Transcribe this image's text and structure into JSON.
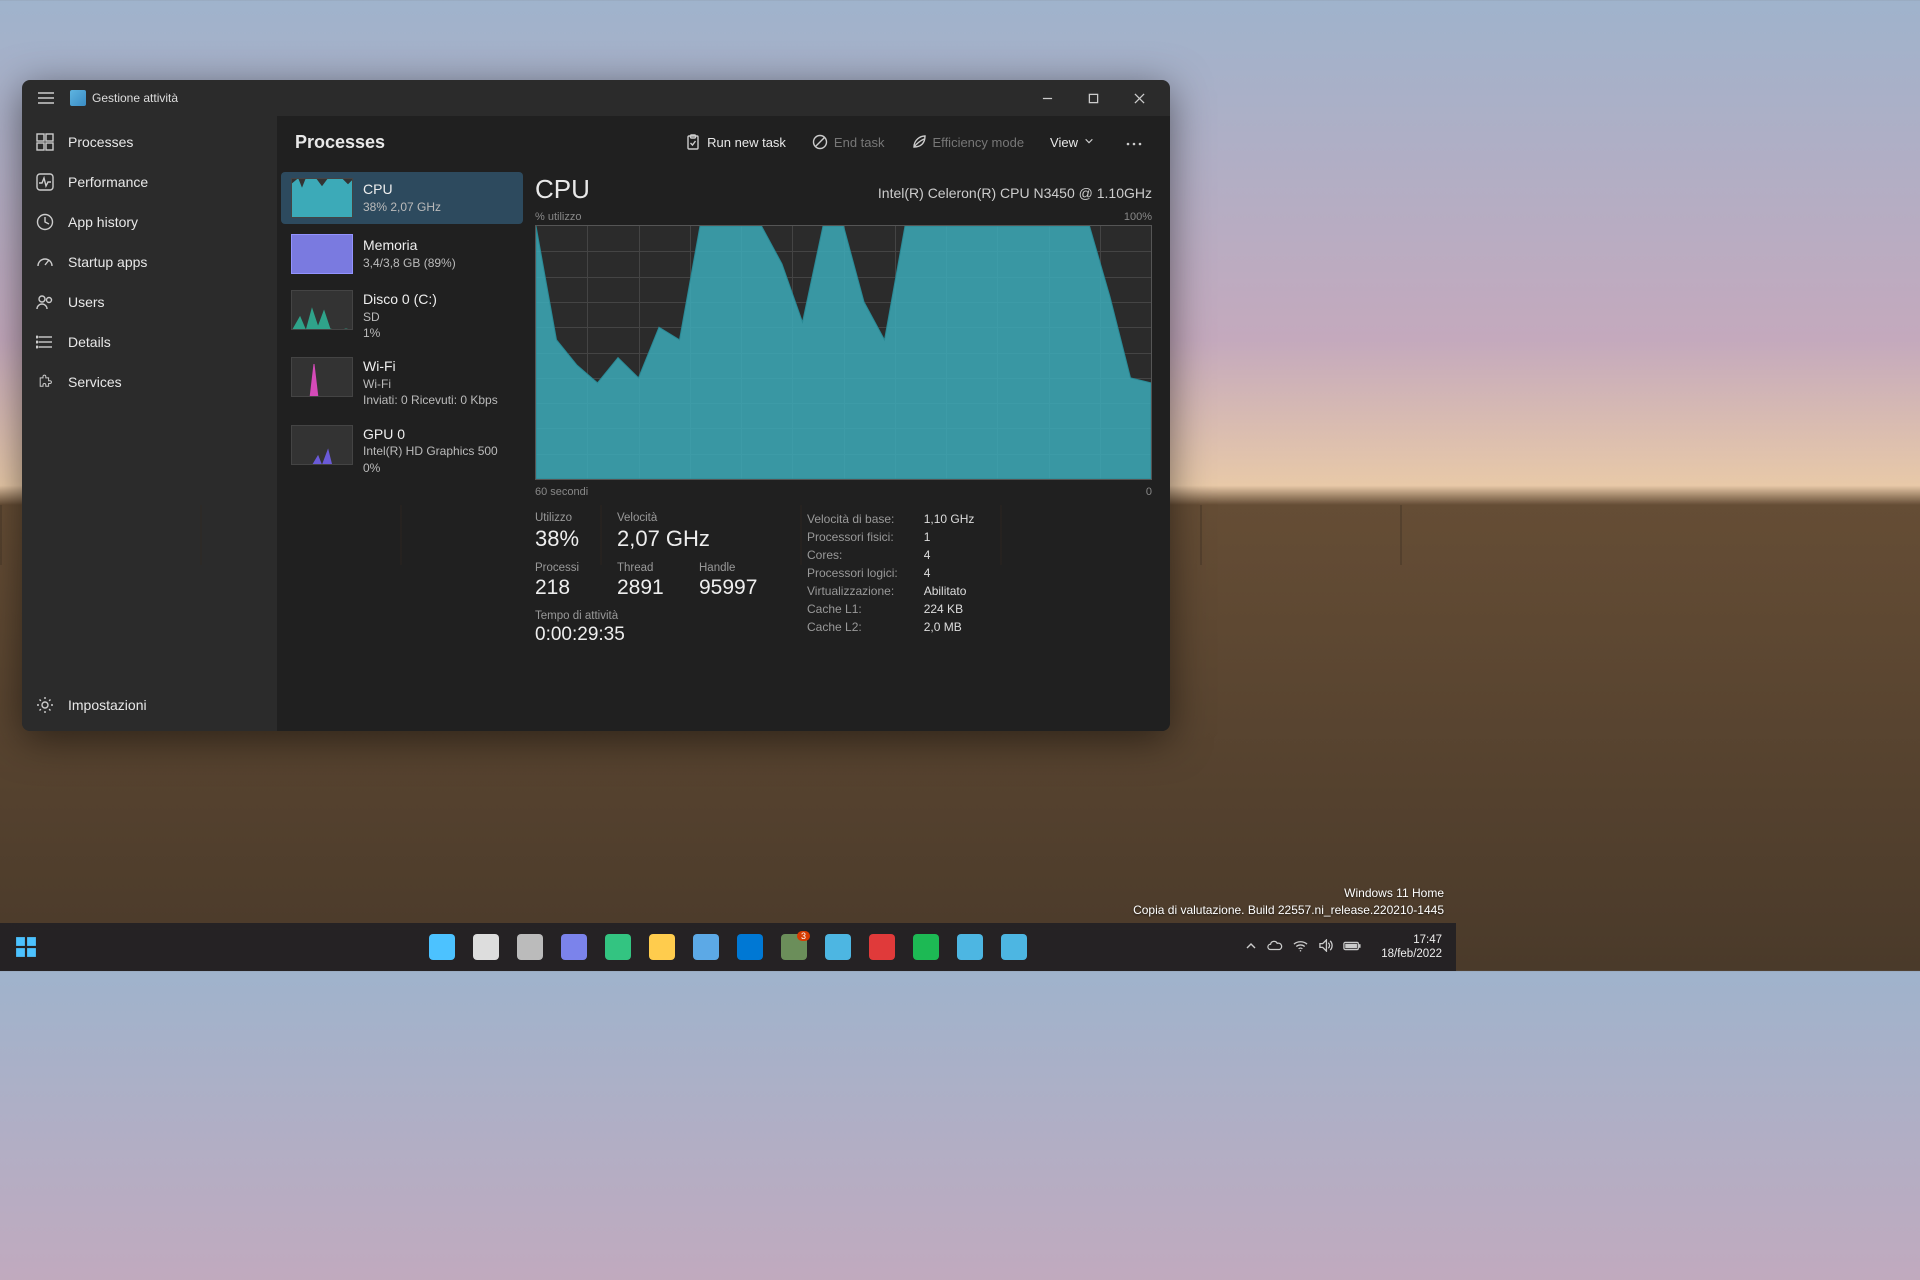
{
  "window": {
    "app_title": "Gestione attività",
    "page_title": "Processes",
    "toolbar": {
      "run_new_task": "Run new task",
      "end_task": "End task",
      "efficiency": "Efficiency mode",
      "view": "View"
    }
  },
  "sidebar": {
    "items": [
      {
        "label": "Processes"
      },
      {
        "label": "Performance"
      },
      {
        "label": "App history"
      },
      {
        "label": "Startup apps"
      },
      {
        "label": "Users"
      },
      {
        "label": "Details"
      },
      {
        "label": "Services"
      }
    ],
    "settings": "Impostazioni"
  },
  "perf_items": [
    {
      "name": "CPU",
      "sub": "38%  2,07 GHz",
      "color": "#3caab8"
    },
    {
      "name": "Memoria",
      "sub": "3,4/3,8 GB (89%)",
      "color": "#7a7ae0"
    },
    {
      "name": "Disco 0 (C:)",
      "sub1": "SD",
      "sub2": "1%",
      "color": "#2fa38a"
    },
    {
      "name": "Wi-Fi",
      "sub1": "Wi-Fi",
      "sub2": "Inviati: 0  Ricevuti: 0 Kbps",
      "color": "#d44ab8"
    },
    {
      "name": "GPU 0",
      "sub1": "Intel(R) HD Graphics 500",
      "sub2": "0%",
      "color": "#6a5ad8"
    }
  ],
  "detail": {
    "title": "CPU",
    "model": "Intel(R) Celeron(R) CPU N3450 @ 1.10GHz",
    "axis_top_left": "% utilizzo",
    "axis_top_right": "100%",
    "axis_bot_left": "60 secondi",
    "axis_bot_right": "0",
    "left_stats": {
      "utilizzo_lbl": "Utilizzo",
      "utilizzo_val": "38%",
      "velocita_lbl": "Velocità",
      "velocita_val": "2,07 GHz",
      "processi_lbl": "Processi",
      "processi_val": "218",
      "thread_lbl": "Thread",
      "thread_val": "2891",
      "handle_lbl": "Handle",
      "handle_val": "95997",
      "uptime_lbl": "Tempo di attività",
      "uptime_val": "0:00:29:35"
    },
    "right_stats": [
      [
        "Velocità di base:",
        "1,10 GHz"
      ],
      [
        "Processori fisici:",
        "1"
      ],
      [
        "Cores:",
        "4"
      ],
      [
        "Processori logici:",
        "4"
      ],
      [
        "Virtualizzazione:",
        "Abilitato"
      ],
      [
        "Cache L1:",
        "224 KB"
      ],
      [
        "Cache L2:",
        "2,0 MB"
      ]
    ]
  },
  "chart_data": {
    "type": "area",
    "title": "CPU % utilizzo",
    "xlabel": "secondi",
    "ylabel": "% utilizzo",
    "xlim": [
      60,
      0
    ],
    "ylim": [
      0,
      100
    ],
    "x": [
      60,
      58,
      56,
      54,
      52,
      50,
      48,
      46,
      44,
      42,
      40,
      38,
      36,
      34,
      32,
      30,
      28,
      26,
      24,
      22,
      20,
      18,
      16,
      14,
      12,
      10,
      8,
      6,
      4,
      2,
      0
    ],
    "values": [
      100,
      55,
      45,
      38,
      48,
      40,
      60,
      55,
      100,
      100,
      100,
      100,
      85,
      62,
      100,
      100,
      70,
      55,
      100,
      100,
      100,
      100,
      100,
      100,
      100,
      100,
      100,
      100,
      72,
      40,
      38
    ],
    "color": "#3caab8"
  },
  "desktop_overlay": {
    "line1": "Windows 11 Home",
    "line2": "Copia di valutazione. Build 22557.ni_release.220210-1445"
  },
  "taskbar": {
    "apps": [
      {
        "name": "start",
        "color": "#4cc2ff"
      },
      {
        "name": "search",
        "color": "#ddd"
      },
      {
        "name": "task-view",
        "color": "#bbb"
      },
      {
        "name": "chat",
        "color": "#7b83eb"
      },
      {
        "name": "edge",
        "color": "#33c481"
      },
      {
        "name": "files",
        "color": "#ffcc4d"
      },
      {
        "name": "store",
        "color": "#5ca9e6"
      },
      {
        "name": "mail",
        "color": "#0078d4"
      },
      {
        "name": "todo",
        "color": "#6b8e5a",
        "badge": "3"
      },
      {
        "name": "photos",
        "color": "#4db6e2"
      },
      {
        "name": "media",
        "color": "#e03a3a"
      },
      {
        "name": "spotify",
        "color": "#1db954"
      },
      {
        "name": "news",
        "color": "#4db6e2"
      },
      {
        "name": "task-manager",
        "color": "#4db6e2"
      }
    ],
    "clock": {
      "time": "17:47",
      "date": "18/feb/2022"
    }
  }
}
